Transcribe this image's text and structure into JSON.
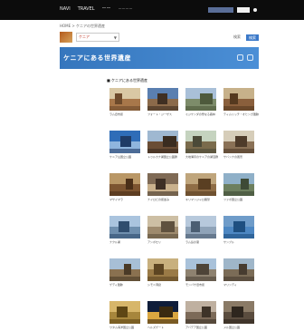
{
  "topbar": {
    "nav": [
      "NAVI",
      "TRAVEL",
      "ーー"
    ],
    "subnav": "ーーーー"
  },
  "breadcrumb": "HOME > ケニアの世界遺産",
  "country_select": {
    "value": "ケニア"
  },
  "search": {
    "label": "検索",
    "button": "検索"
  },
  "hero": {
    "title": "ケニアにある世界遺産"
  },
  "section": {
    "title": "■ ケニアにある世界遺産"
  },
  "tiles": [
    {
      "caption": "ラム旧市街",
      "icon": "desert-city-photo"
    },
    {
      "caption": "フォート・ジーザス",
      "icon": "fort-photo"
    },
    {
      "caption": "ミジケンダの聖なる森林",
      "icon": "mountain-photo"
    },
    {
      "caption": "ティムリッチ・オヒンガ遺跡",
      "icon": "ruins-photo"
    },
    {
      "caption": "ケニア山国立公園",
      "icon": "statue-photo"
    },
    {
      "caption": "トゥルカナ湖国立公園群",
      "icon": "harbor-photo"
    },
    {
      "caption": "大地溝帯のケニアの湖沼群",
      "icon": "palace-photo"
    },
    {
      "caption": "サバンナの風景",
      "icon": "castle-photo"
    },
    {
      "caption": "マサイマラ",
      "icon": "temple-photo"
    },
    {
      "caption": "ナイロビの街並み",
      "icon": "cathedral-photo"
    },
    {
      "caption": "キリマンジャロ展望",
      "icon": "cliff-photo"
    },
    {
      "caption": "ツァボ国立公園",
      "icon": "valley-photo"
    },
    {
      "caption": "ナクル湖",
      "icon": "waterfront-photo"
    },
    {
      "caption": "アンボセリ",
      "icon": "dome-photo"
    },
    {
      "caption": "ラム島の港",
      "icon": "stadium-photo"
    },
    {
      "caption": "サンブル",
      "icon": "lake-photo"
    },
    {
      "caption": "ゲディ遺跡",
      "icon": "village-photo"
    },
    {
      "caption": "シモニ洞窟",
      "icon": "pyramid-photo"
    },
    {
      "caption": "モンバサ旧市街",
      "icon": "canal-photo"
    },
    {
      "caption": "マリンディ",
      "icon": "riverside-photo"
    },
    {
      "caption": "ワタム海洋国立公園",
      "icon": "monument-photo"
    },
    {
      "caption": "ヘルズゲート",
      "icon": "night-tower-photo"
    },
    {
      "caption": "アバデア国立公園",
      "icon": "statues-photo"
    },
    {
      "caption": "メル国立公園",
      "icon": "church-photo"
    }
  ]
}
